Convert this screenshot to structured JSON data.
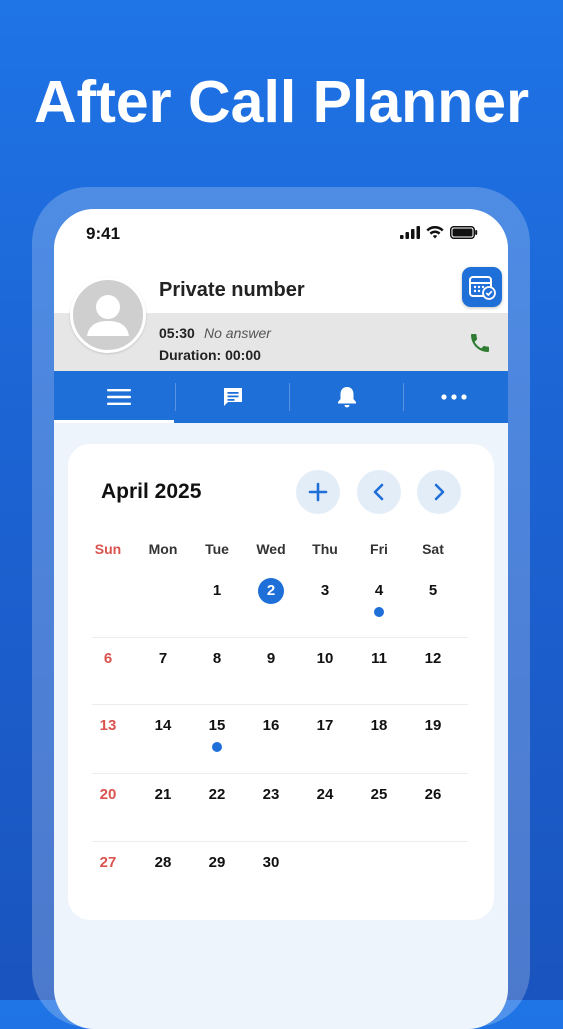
{
  "promo": {
    "headline": "After Call Planner"
  },
  "status_bar": {
    "time": "9:41"
  },
  "call": {
    "caller": "Private number",
    "time": "05:30",
    "status": "No answer",
    "duration": "Duration: 00:00"
  },
  "tabs": [
    {
      "icon": "menu-icon",
      "active": true
    },
    {
      "icon": "message-icon",
      "active": false
    },
    {
      "icon": "bell-icon",
      "active": false
    },
    {
      "icon": "more-icon",
      "active": false
    }
  ],
  "calendar": {
    "month_label": "April 2025",
    "weekdays": [
      "Sun",
      "Mon",
      "Tue",
      "Wed",
      "Thu",
      "Fri",
      "Sat"
    ],
    "weeks": [
      [
        "",
        "",
        "1",
        "2",
        "3",
        "4",
        "5"
      ],
      [
        "6",
        "7",
        "8",
        "9",
        "10",
        "11",
        "12"
      ],
      [
        "13",
        "14",
        "15",
        "16",
        "17",
        "18",
        "19"
      ],
      [
        "20",
        "21",
        "22",
        "23",
        "24",
        "25",
        "26"
      ],
      [
        "27",
        "28",
        "29",
        "30",
        "",
        "",
        ""
      ]
    ],
    "selected_day": "2",
    "event_days": [
      "4",
      "15"
    ]
  },
  "colors": {
    "accent": "#1f6fd9",
    "sunday": "#d9534f",
    "call_green": "#2e7d32"
  }
}
